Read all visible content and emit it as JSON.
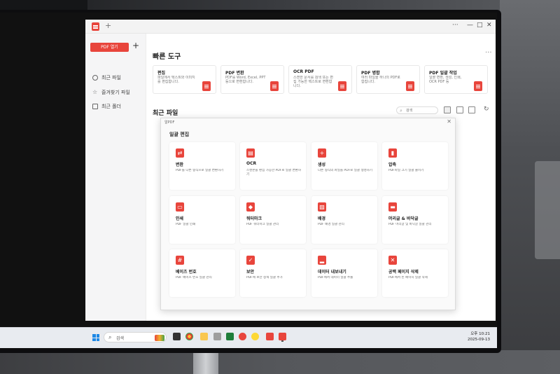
{
  "app": {
    "new_tab_symbol": "+",
    "window_controls": [
      "···",
      "—",
      "□",
      "✕"
    ]
  },
  "sidebar": {
    "open_pdf_label": "PDF 열기",
    "add_symbol": "+",
    "items": [
      {
        "label": "최근 파일",
        "icon": "clock-icon"
      },
      {
        "label": "즐겨찾기 파일",
        "icon": "star-icon"
      },
      {
        "label": "최근 폴더",
        "icon": "folder-icon"
      }
    ]
  },
  "quick_tools": {
    "heading": "빠른 도구",
    "more": "···",
    "cards": [
      {
        "title": "편집",
        "desc": "파일에서 텍스트와 이미지를 편집합니다."
      },
      {
        "title": "PDF 변환",
        "desc": "PDF를 Word, Excel, PPT 등으로 변환합니다."
      },
      {
        "title": "OCR PDF",
        "desc": "스캔한 문서를 검색 또는 편집 가능한 텍스트로 변환합니다."
      },
      {
        "title": "PDF 병합",
        "desc": "여러 파일을 하나의 PDF로 합칩니다."
      },
      {
        "title": "PDF 일괄 작업",
        "desc": "일괄 변환, 생성, 인쇄, OCR PDF 등"
      }
    ]
  },
  "recent": {
    "heading": "최근 파일",
    "search_placeholder": "검색",
    "search_symbol": "⌕",
    "refresh_symbol": "↻"
  },
  "dialog": {
    "title": "알PDF",
    "close_symbol": "✕",
    "heading": "일괄 편집",
    "items": [
      {
        "title": "변환",
        "desc": "PDF를 다른 형식으로 일괄 변환하기",
        "icon": "convert-icon",
        "glyph": "⇄"
      },
      {
        "title": "OCR",
        "desc": "스캔본을 편집 가능한 PDF로 일괄 변환하기",
        "icon": "ocr-icon",
        "glyph": "▤"
      },
      {
        "title": "생성",
        "desc": "다른 형식의 파일을 PDF로 일괄 생성하기",
        "icon": "create-icon",
        "glyph": "+"
      },
      {
        "title": "압축",
        "desc": "PDF파일 크기 일괄 줄이기",
        "icon": "compress-icon",
        "glyph": "▮"
      },
      {
        "title": "인쇄",
        "desc": "PDF 일괄 인쇄",
        "icon": "print-icon",
        "glyph": "▭"
      },
      {
        "title": "워터마크",
        "desc": "PDF 워터마크 일괄 관리",
        "icon": "watermark-icon",
        "glyph": "◆"
      },
      {
        "title": "배경",
        "desc": "PDF 배경 일괄 관리",
        "icon": "background-icon",
        "glyph": "▨"
      },
      {
        "title": "머리글 & 바닥글",
        "desc": "PDF 머리글 및 바닥글 일괄 관리",
        "icon": "header-footer-icon",
        "glyph": "▬"
      },
      {
        "title": "베이츠 번호",
        "desc": "PDF 베이츠 번호 일괄 관리",
        "icon": "bates-number-icon",
        "glyph": "#"
      },
      {
        "title": "보안",
        "desc": "PDF에 보안 정책 일괄 추가",
        "icon": "security-icon",
        "glyph": "✓"
      },
      {
        "title": "데이터 내보내기",
        "desc": "PDF에서 데이터 일괄 추출",
        "icon": "export-data-icon",
        "glyph": "▂"
      },
      {
        "title": "공백 페이지 삭제",
        "desc": "PDF에서 빈 페이지 일괄 삭제",
        "icon": "delete-blank-page-icon",
        "glyph": "✕"
      }
    ]
  },
  "taskbar": {
    "search_text": "검색",
    "time": "오후 10:21",
    "date": "2025-09-13"
  },
  "colors": {
    "accent": "#e8453c"
  }
}
